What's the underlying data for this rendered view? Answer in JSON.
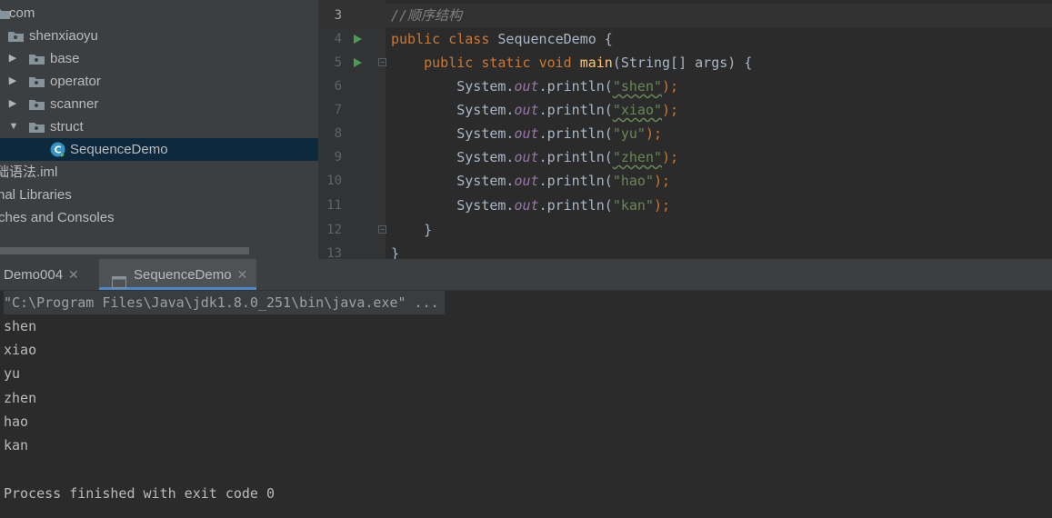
{
  "project_tree": {
    "items": [
      {
        "label": "com",
        "depth": 0
      },
      {
        "label": "shenxiaoyu",
        "depth": 1
      },
      {
        "label": "base",
        "depth": 2
      },
      {
        "label": "operator",
        "depth": 2
      },
      {
        "label": "scanner",
        "depth": 2
      },
      {
        "label": "struct",
        "depth": 2
      },
      {
        "label": "SequenceDemo",
        "depth": 3
      },
      {
        "label": "础语法.iml"
      },
      {
        "label": "nal Libraries"
      },
      {
        "label": "ches and Consoles"
      }
    ],
    "selected": "SequenceDemo"
  },
  "editor": {
    "lines": [
      {
        "num": "3",
        "text": "//顺序结构"
      },
      {
        "num": "4",
        "parts": [
          "public",
          "class",
          "SequenceDemo {"
        ]
      },
      {
        "num": "5",
        "parts": [
          "public",
          "static",
          "void",
          "main",
          "(String[] args) {"
        ]
      },
      {
        "num": "6",
        "parts": [
          "System.",
          "out",
          ".println(",
          "\"shen\"",
          ");"
        ]
      },
      {
        "num": "7",
        "parts": [
          "System.",
          "out",
          ".println(",
          "\"xiao\"",
          ");"
        ]
      },
      {
        "num": "8",
        "parts": [
          "System.",
          "out",
          ".println(",
          "\"yu\"",
          ");"
        ]
      },
      {
        "num": "9",
        "parts": [
          "System.",
          "out",
          ".println(",
          "\"zhen\"",
          ");"
        ]
      },
      {
        "num": "10",
        "parts": [
          "System.",
          "out",
          ".println(",
          "\"hao\"",
          ");"
        ]
      },
      {
        "num": "11",
        "parts": [
          "System.",
          "out",
          ".println(",
          "\"kan\"",
          ");"
        ]
      },
      {
        "num": "12",
        "text": "}"
      },
      {
        "num": "13",
        "text": "}"
      }
    ]
  },
  "run_tabs": [
    {
      "label": "Demo004",
      "active": false
    },
    {
      "label": "SequenceDemo",
      "active": true
    }
  ],
  "console": {
    "command": "\"C:\\Program Files\\Java\\jdk1.8.0_251\\bin\\java.exe\" ...",
    "output": [
      "shen",
      "xiao",
      "yu",
      "zhen",
      "hao",
      "kan"
    ],
    "exit_message": "Process finished with exit code 0"
  },
  "colors": {
    "keyword": "#cc7832",
    "string": "#6a8759",
    "method": "#ffc66d",
    "field": "#9876aa",
    "comment": "#808080",
    "selection": "#0d293e",
    "run_icon": "#499c54"
  },
  "icons": {
    "folder": "package-folder-icon",
    "class": "java-class-icon",
    "run": "run-gutter-icon",
    "tab": "run-config-icon",
    "close": "close-icon"
  }
}
